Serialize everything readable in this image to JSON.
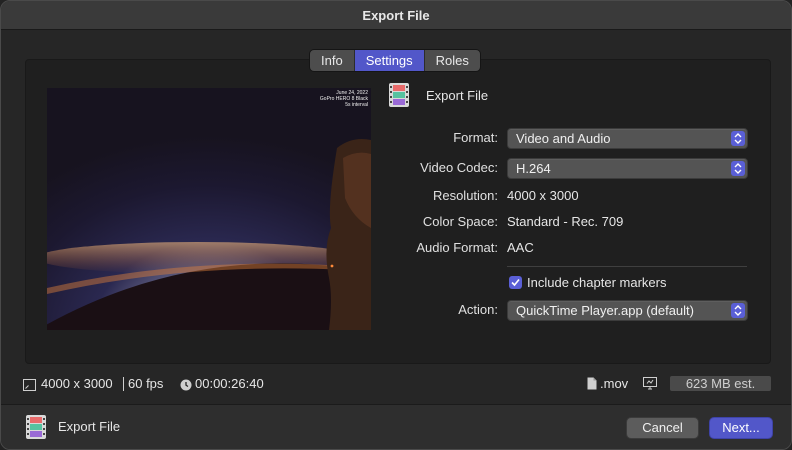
{
  "window": {
    "title": "Export File"
  },
  "tabs": [
    {
      "label": "Info",
      "active": false
    },
    {
      "label": "Settings",
      "active": true
    },
    {
      "label": "Roles",
      "active": false
    }
  ],
  "preview": {
    "overlay_lines": [
      "June 24, 2022",
      "GoPro HERO 8 Black",
      "5s interval"
    ]
  },
  "settings": {
    "title": "Export File",
    "title_icon": "film-strip-icon",
    "format": {
      "label": "Format:",
      "value": "Video and Audio"
    },
    "video_codec": {
      "label": "Video Codec:",
      "value": "H.264"
    },
    "resolution": {
      "label": "Resolution:",
      "value": "4000 x 3000"
    },
    "color_space": {
      "label": "Color Space:",
      "value": "Standard - Rec. 709"
    },
    "audio_format": {
      "label": "Audio Format:",
      "value": "AAC"
    },
    "chapter_markers": {
      "label": "Include chapter markers",
      "checked": true
    },
    "action": {
      "label": "Action:",
      "value": "QuickTime Player.app (default)"
    }
  },
  "info_bar": {
    "dimensions": "4000 x 3000",
    "fps": "60 fps",
    "duration": "00:00:26:40",
    "extension": ".mov",
    "size_estimate": "623 MB est."
  },
  "footer": {
    "label": "Export File",
    "cancel_label": "Cancel",
    "next_label": "Next..."
  },
  "colors": {
    "accent": "#5257c9",
    "window_bg": "#262626",
    "titlebar_bg": "#3a3a3a"
  }
}
